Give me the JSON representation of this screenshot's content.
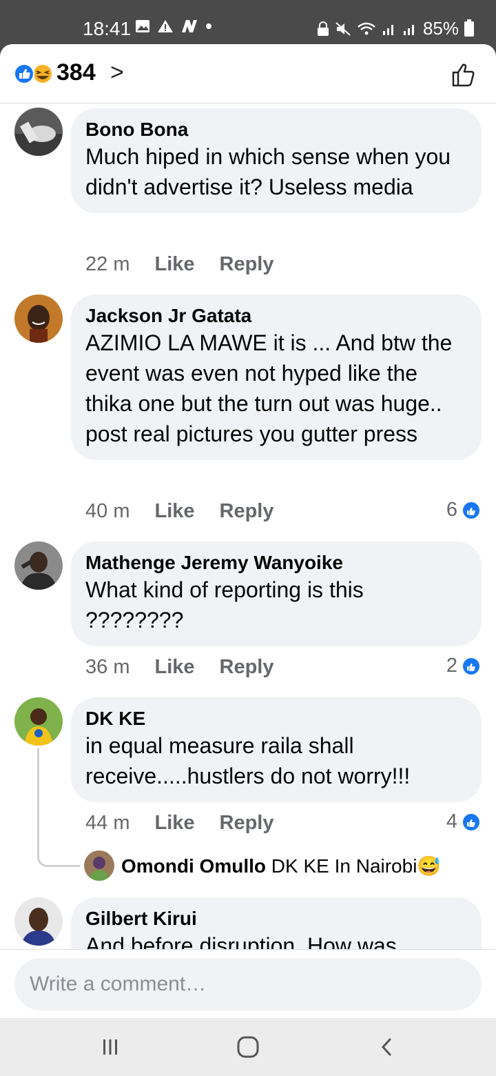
{
  "status_bar": {
    "time": "18:41",
    "battery": "85%",
    "icons": [
      "image-icon",
      "warning-icon",
      "n-icon",
      "dot-icon",
      "lock-icon",
      "mute-icon",
      "wifi-icon",
      "signal-icon",
      "signal-icon",
      "battery-icon"
    ]
  },
  "header": {
    "reaction_icons": [
      "like-reaction-icon",
      "haha-reaction-icon"
    ],
    "reaction_count": "384",
    "chevron": ">",
    "like_icon": "thumbs-up-outline-icon"
  },
  "comments": [
    {
      "author": "Bono Bona",
      "text": "Much hiped in which sense when you didn't advertise it? Useless media",
      "time": "22 m",
      "like_label": "Like",
      "reply_label": "Reply",
      "likes": ""
    },
    {
      "author": "Jackson Jr Gatata",
      "text": "AZIMIO LA MAWE it is ... And btw the event was even not hyped like the thika one but the turn out was huge.. post real pictures you gutter press",
      "time": "40 m",
      "like_label": "Like",
      "reply_label": "Reply",
      "likes": "6"
    },
    {
      "author": "Mathenge Jeremy Wanyoike",
      "text": "What kind of reporting is this ????????",
      "time": "36 m",
      "like_label": "Like",
      "reply_label": "Reply",
      "likes": "2"
    },
    {
      "author": "DK KE",
      "text": "in equal measure raila shall receive.....hustlers do not worry!!!",
      "time": "44 m",
      "like_label": "Like",
      "reply_label": "Reply",
      "likes": "4",
      "reply_preview": {
        "author": "Omondi Omullo",
        "text": "DK KE In Nairobi",
        "emoji": "😅"
      }
    },
    {
      "author": "Gilbert Kirui",
      "text": "And before disruption. How was"
    }
  ],
  "composer": {
    "placeholder": "Write a comment…"
  },
  "navbar": {
    "icons": [
      "recent-apps-icon",
      "home-icon",
      "back-icon"
    ]
  }
}
